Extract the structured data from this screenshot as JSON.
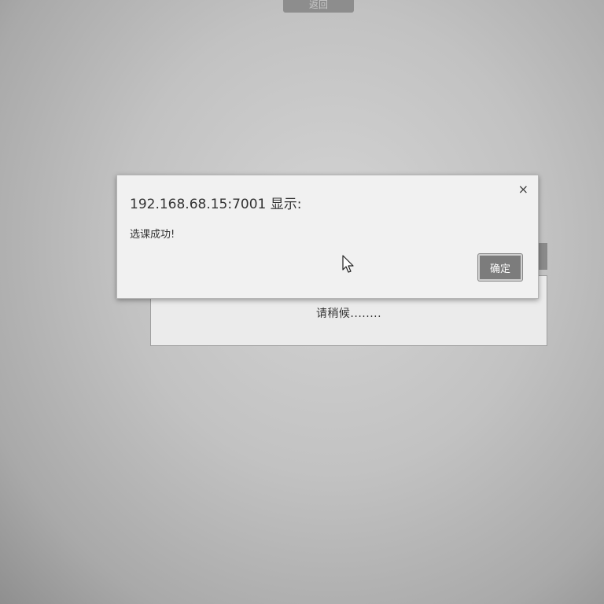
{
  "background": {
    "top_button_label": "返回"
  },
  "loading": {
    "text": "请稍候........"
  },
  "alert": {
    "title": "192.168.68.15:7001 显示:",
    "message": "选课成功!",
    "close_symbol": "×",
    "ok_label": "确定"
  },
  "colors": {
    "ok_button": "#7c7c7c",
    "dialog_bg": "#f1f1f1"
  },
  "icons": {
    "close": "close-icon",
    "cursor": "mouse-pointer-icon"
  }
}
